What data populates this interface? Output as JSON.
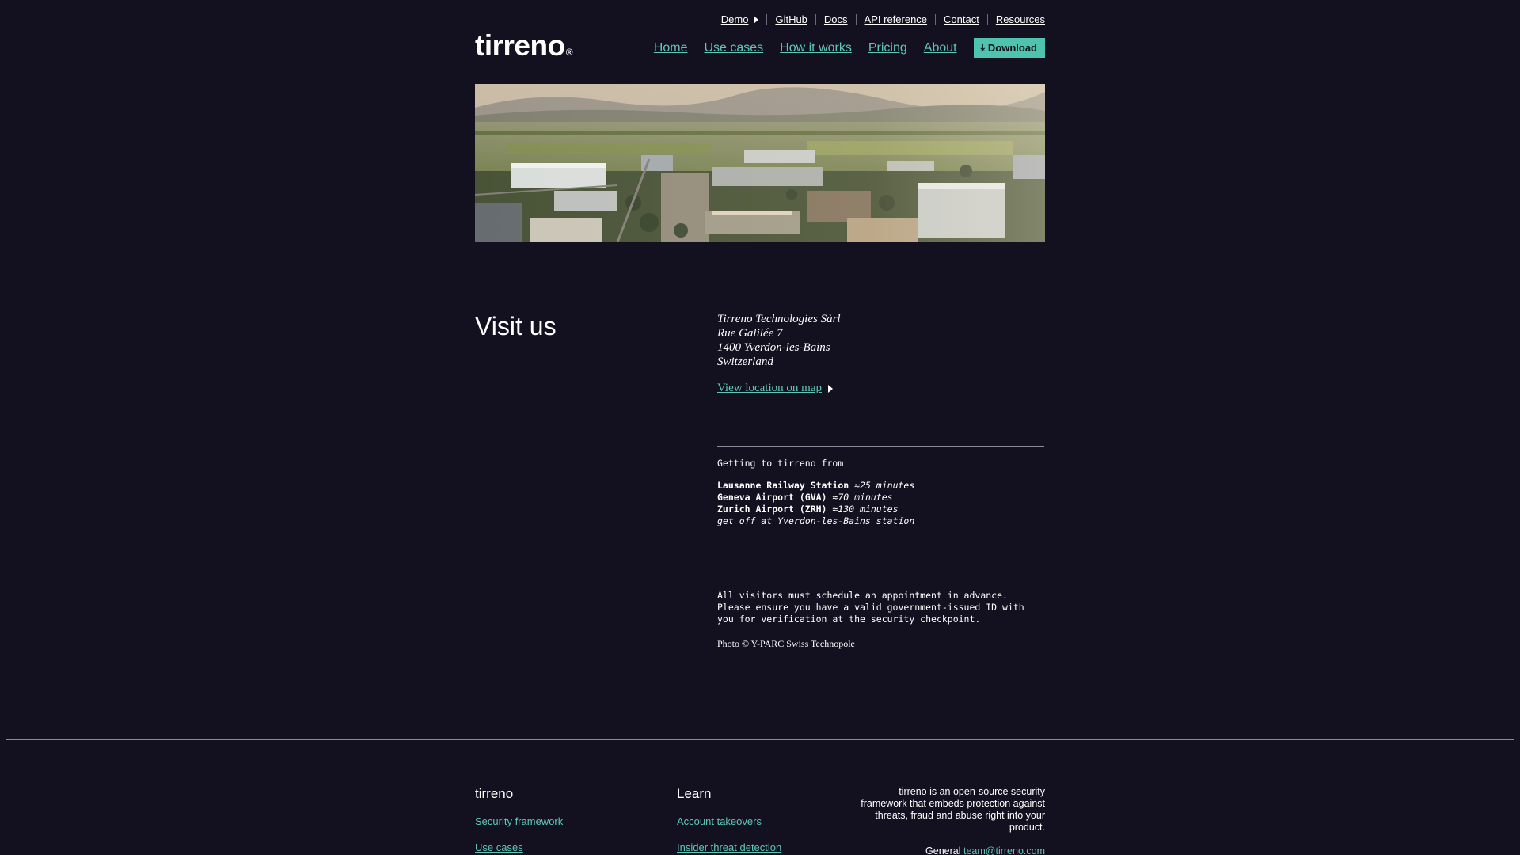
{
  "topnav": {
    "items": [
      {
        "label": "Demo"
      },
      {
        "label": "GitHub"
      },
      {
        "label": "Docs"
      },
      {
        "label": "API reference"
      },
      {
        "label": "Contact"
      },
      {
        "label": "Resources"
      }
    ]
  },
  "brand": {
    "name": "tirreno",
    "mark": "®"
  },
  "mainnav": {
    "items": [
      {
        "label": "Home"
      },
      {
        "label": "Use cases"
      },
      {
        "label": "How it works"
      },
      {
        "label": "Pricing"
      },
      {
        "label": "About"
      }
    ],
    "download_label": "Download",
    "accent": "#4ec3ae",
    "link_color": "#5ec8b8"
  },
  "visit": {
    "title": "Visit us",
    "address": [
      "Tirreno Technologies Sàrl",
      "Rue Galilée 7",
      "1400 Yverdon-les-Bains",
      "Switzerland"
    ],
    "map_link": "View location on map",
    "getting_title": "Getting to tirreno from",
    "routes": [
      {
        "place": "Lausanne Railway Station",
        "time": "≈25 minutes"
      },
      {
        "place": "Geneva Airport (GVA)",
        "time": "≈70 minutes"
      },
      {
        "place": "Zurich Airport (ZRH)",
        "time": "≈130 minutes"
      }
    ],
    "route_note": "get off at Yverdon-les-Bains station",
    "notice_lines": [
      "All visitors must schedule an appointment in advance.",
      "Please ensure you have a valid government-issued ID with",
      "you for verification at the security checkpoint."
    ],
    "photo_credit": "Photo © Y-PARC Swiss Technopole"
  },
  "footer": {
    "col1_title": "tirreno",
    "col1_links": [
      "Security framework",
      "Use cases"
    ],
    "col2_title": "Learn",
    "col2_links": [
      "Account takeovers",
      "Insider threat detection"
    ],
    "about_text": "tirreno is an open-source security framework that embeds protection against threats, fraud and abuse right into your product.",
    "general_label": "General",
    "general_email": "team@tirreno.com"
  },
  "background": "#13111f"
}
